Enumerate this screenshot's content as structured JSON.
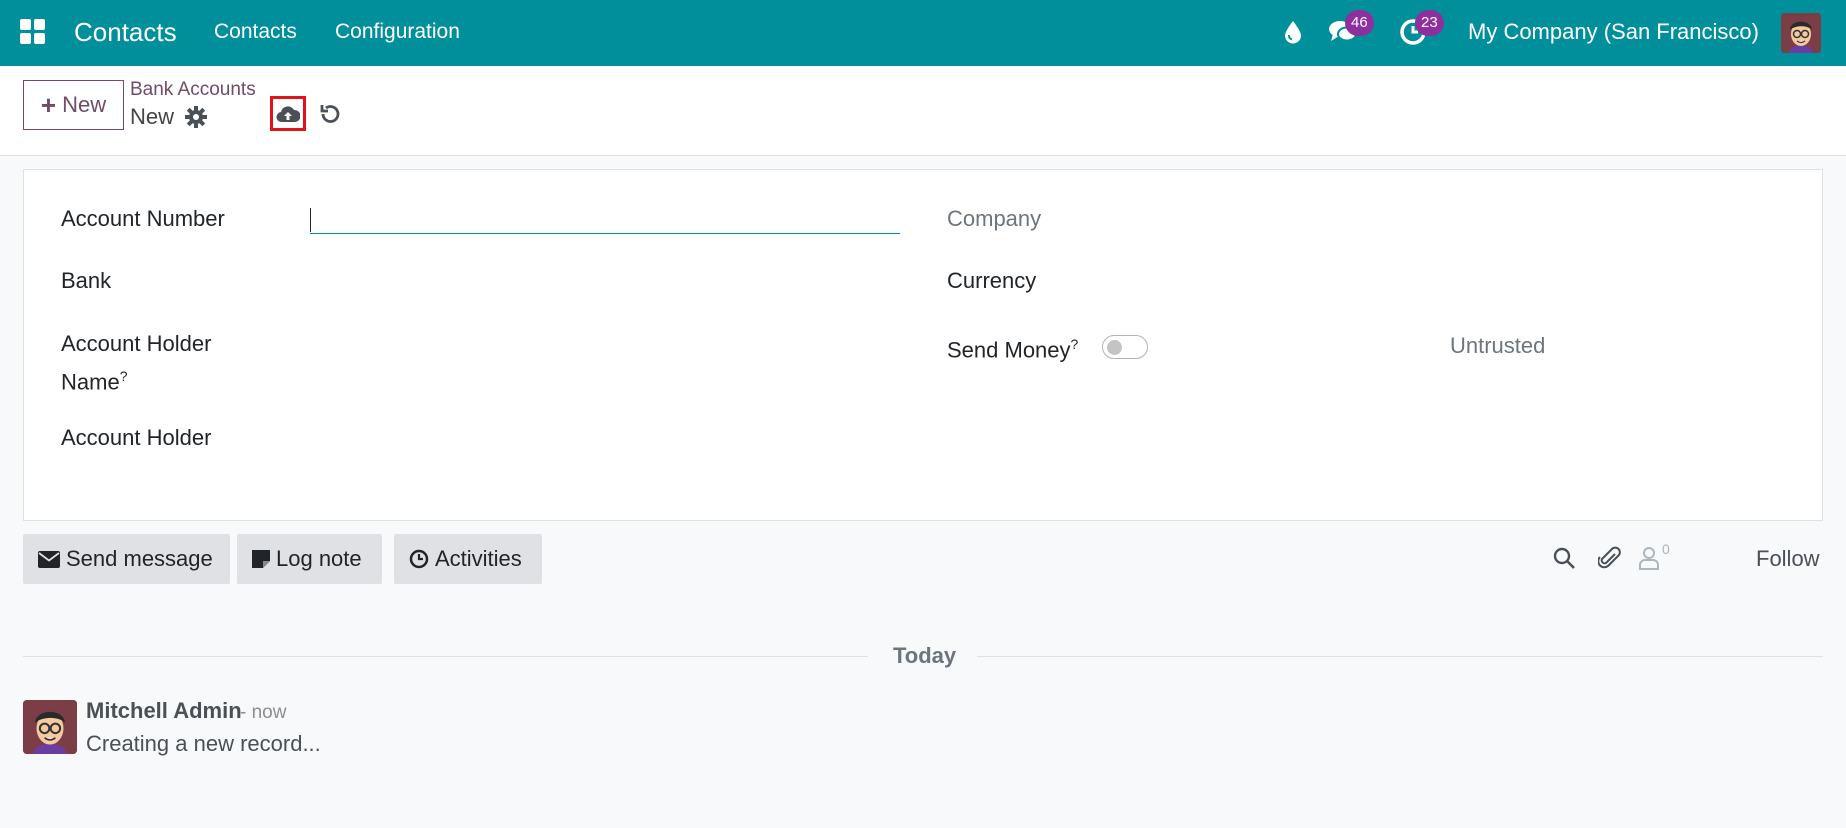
{
  "navbar": {
    "app_title": "Contacts",
    "menu": [
      "Contacts",
      "Configuration"
    ],
    "messages_count": "46",
    "activities_count": "23",
    "company": "My Company (San Francisco)",
    "background_color": "#018f9c"
  },
  "control_panel": {
    "new_button": "New",
    "breadcrumb_parent": "Bank Accounts",
    "breadcrumb_current": "New"
  },
  "form": {
    "account_number_label": "Account Number",
    "account_number_value": "",
    "bank_label": "Bank",
    "holder_name_label_1": "Account Holder",
    "holder_name_label_2": "Name",
    "holder_label": "Account Holder",
    "company_label": "Company",
    "currency_label": "Currency",
    "send_money_label": "Send Money",
    "help_mark": "?",
    "send_money_enabled": false,
    "trust_status": "Untrusted"
  },
  "chatter": {
    "send_message": "Send message",
    "log_note": "Log note",
    "activities": "Activities",
    "followers_count": "0",
    "follow": "Follow",
    "date_separator": "Today",
    "message": {
      "author": "Mitchell Admin",
      "time": "- now",
      "body": "Creating a new record..."
    }
  },
  "colors": {
    "accent": "#714b67",
    "badge": "#8e2fa0",
    "save_highlight": "#e0121b"
  }
}
